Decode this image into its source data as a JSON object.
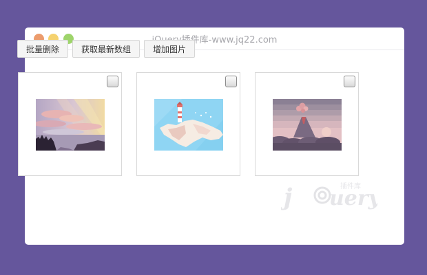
{
  "window": {
    "title": "jQuery插件库-www.jq22.com",
    "colors": {
      "background": "#65569c",
      "close_dot": "#ec9c6d",
      "minimize_dot": "#f5d26f",
      "maximize_dot": "#9ed46b"
    }
  },
  "toolbar": {
    "buttons": [
      {
        "label": "批量删除"
      },
      {
        "label": "获取最新数组"
      },
      {
        "label": "增加图片"
      }
    ]
  },
  "gallery": {
    "items": [
      {
        "image": "pastel-mountain-sunset-illustration",
        "checked": false
      },
      {
        "image": "lighthouse-on-cliff-illustration",
        "checked": false
      },
      {
        "image": "erupting-volcano-illustration",
        "checked": false
      }
    ]
  },
  "watermark": {
    "logo_text": "jQuery",
    "sub_text": "插件库"
  }
}
